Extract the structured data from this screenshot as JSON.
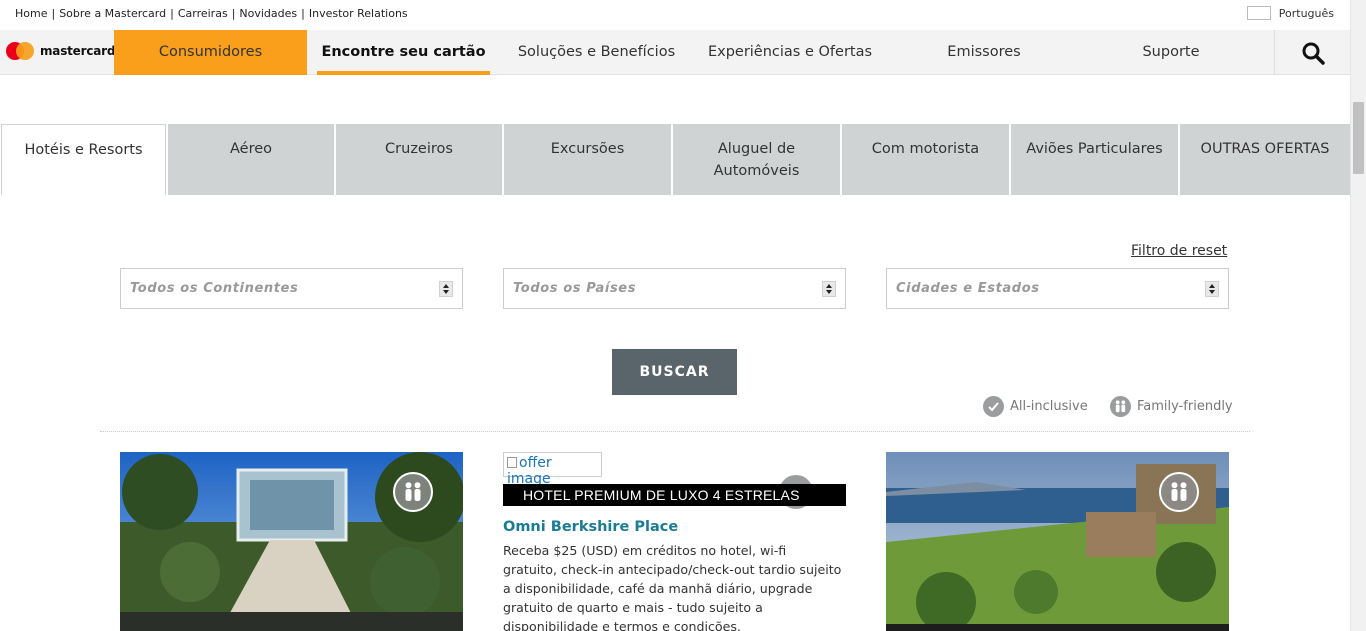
{
  "top_links": [
    "Home",
    "Sobre a Mastercard",
    "Carreiras",
    "Novidades",
    "Investor Relations"
  ],
  "language": "Português",
  "logo_text": "mastercard",
  "nav": {
    "consumers": "Consumidores",
    "find_card": "Encontre seu cartão",
    "solutions": "Soluções e Benefícios",
    "experiences": "Experiências e Ofertas",
    "issuers": "Emissores",
    "support": "Suporte"
  },
  "tabs": [
    {
      "label": "Hotéis e Resorts"
    },
    {
      "label": "Aéreo"
    },
    {
      "label": "Cruzeiros"
    },
    {
      "label": "Excursões"
    },
    {
      "label": "Aluguel de Automóveis"
    },
    {
      "label": "Com motorista"
    },
    {
      "label": "Aviões Particulares"
    },
    {
      "label": "OUTRAS OFERTAS"
    }
  ],
  "filters": {
    "reset": "Filtro de reset",
    "continents": "Todos os Continentes",
    "countries": "Todos os Países",
    "cities": "Cidades e Estados",
    "search": "BUSCAR"
  },
  "legend": {
    "all_inclusive": "All-inclusive",
    "family_friendly": "Family-friendly"
  },
  "offer": {
    "alt": "offer image",
    "band": "HOTEL PREMIUM DE LUXO 4 ESTRELAS",
    "title": "Omni Berkshire Place",
    "description": "Receba $25 (USD) em créditos no hotel, wi-fi gratuito, check-in antecipado/check-out tardio sujeito a disponibilidade, café da manhã diário, upgrade gratuito de quarto e mais - tudo sujeito a disponibilidade e termos e condições."
  },
  "colors": {
    "accent_orange": "#f99f1b",
    "tab_grey": "#d0d3d4",
    "button_grey": "#5a656b",
    "title_teal": "#1b7c91"
  }
}
